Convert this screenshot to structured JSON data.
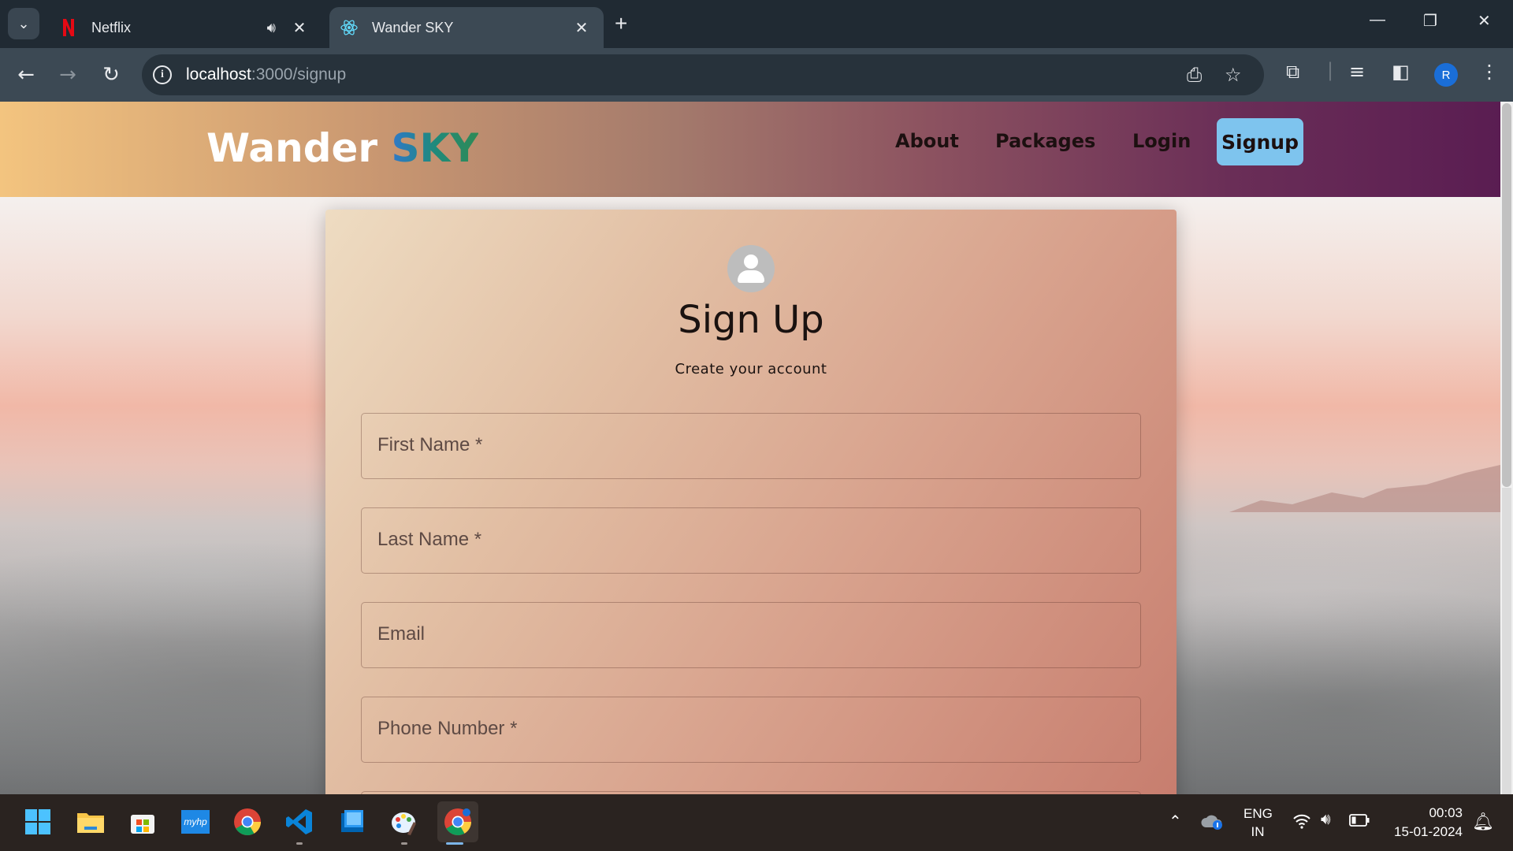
{
  "browser": {
    "tabs": [
      {
        "title": "Netflix",
        "favicon": "netflix-icon",
        "audio": true
      },
      {
        "title": "Wander SKY",
        "favicon": "react-icon",
        "active": true
      }
    ],
    "url_host": "localhost",
    "url_path": ":3000/signup",
    "profile_initial": "R"
  },
  "site": {
    "brand_primary": "Wander",
    "brand_accent": "SKY",
    "nav": {
      "about": "About",
      "packages": "Packages",
      "login": "Login",
      "signup": "Signup"
    }
  },
  "form": {
    "title": "Sign Up",
    "subtitle": "Create your account",
    "fields": [
      {
        "label": "First Name *"
      },
      {
        "label": "Last Name *"
      },
      {
        "label": "Email"
      },
      {
        "label": "Phone Number *"
      }
    ]
  },
  "taskbar": {
    "apps": [
      "windows-start-icon",
      "file-explorer-icon",
      "microsoft-store-icon",
      "myhp-icon",
      "chrome-icon",
      "vscode-icon",
      "app-icon",
      "paint-icon",
      "chrome-profile-icon"
    ],
    "myhp_label": "myhp",
    "lang_top": "ENG",
    "lang_bottom": "IN",
    "time": "00:03",
    "date": "15-01-2024"
  },
  "colors": {
    "header_start": "#f3c47f",
    "header_end": "#5a1d52",
    "signup_button": "#7ec4ee",
    "chrome_tabbar": "#202a33",
    "chrome_toolbar": "#3c4954"
  }
}
